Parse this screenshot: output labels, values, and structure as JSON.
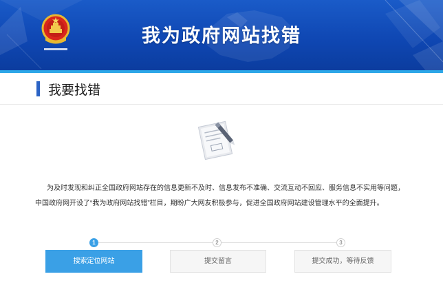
{
  "banner": {
    "title": "我为政府网站找错",
    "emblem_icon": "national-emblem-icon",
    "colors": {
      "background": "#0f47b3",
      "accent_strip": "#2da7e8"
    }
  },
  "section": {
    "title": "我要找错",
    "accent_color": "#2b63c5"
  },
  "illustration": {
    "icon": "document-pen-icon"
  },
  "intro": {
    "line1": "为及时发现和纠正全国政府网站存在的信息更新不及时、信息发布不准确、交流互动不回应、服务信息不实用等问题，",
    "line2": "中国政府网开设了“我为政府网站找错”栏目，期盼广大网友积极参与，促进全国政府网站建设管理水平的全面提升。"
  },
  "steps": [
    {
      "number": "1",
      "label": "搜索定位网站",
      "state": "active"
    },
    {
      "number": "2",
      "label": "提交留言",
      "state": "inactive"
    },
    {
      "number": "3",
      "label": "提交成功，等待反馈",
      "state": "inactive"
    }
  ],
  "colors": {
    "active_step": "#3aa0e6"
  }
}
